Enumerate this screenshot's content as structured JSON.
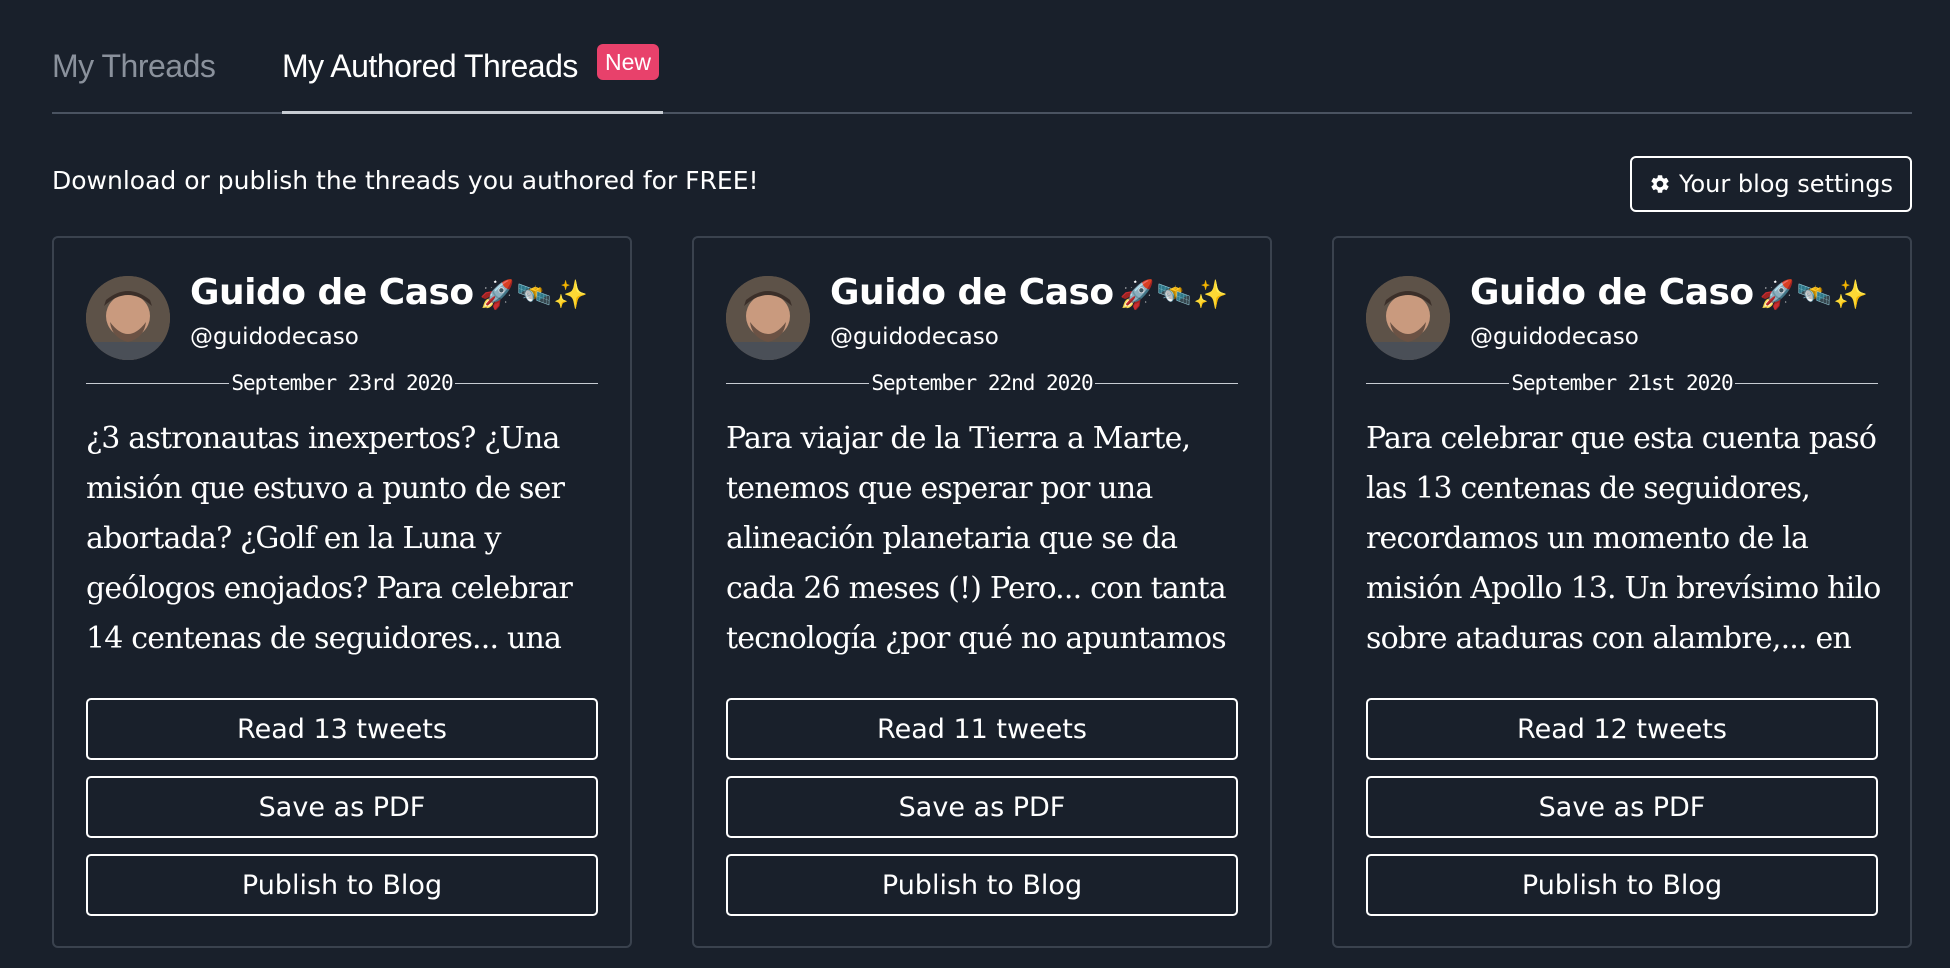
{
  "tabs": {
    "my_threads": "My Threads",
    "my_authored_threads": "My Authored Threads",
    "new_badge": "New"
  },
  "intro": {
    "text": "Download or publish the threads you authored for FREE!",
    "settings_button": "Your blog settings"
  },
  "colors": {
    "background": "#19202b",
    "badge": "#e8416b",
    "card_border": "#3a424e"
  },
  "cards": [
    {
      "author_name": "Guido de Caso",
      "author_emoji": "🚀🛰️✨",
      "handle": "@guidodecaso",
      "date": "September 23rd 2020",
      "excerpt": "¿3 astronautas inexpertos? ¿Una misión que estuvo a punto de ser abortada? ¿Golf en la Luna y geólogos enojados? Para celebrar 14 centenas de seguidores... una",
      "read_label": "Read 13 tweets",
      "pdf_label": "Save as PDF",
      "publish_label": "Publish to Blog"
    },
    {
      "author_name": "Guido de Caso",
      "author_emoji": "🚀🛰️✨",
      "handle": "@guidodecaso",
      "date": "September 22nd 2020",
      "excerpt": "Para viajar de la Tierra a Marte, tenemos que esperar por una alineación planetaria que se da cada 26 meses (!) Pero... con tanta tecnología ¿por qué no apuntamos",
      "read_label": "Read 11 tweets",
      "pdf_label": "Save as PDF",
      "publish_label": "Publish to Blog"
    },
    {
      "author_name": "Guido de Caso",
      "author_emoji": "🚀🛰️✨",
      "handle": "@guidodecaso",
      "date": "September 21st 2020",
      "excerpt": "Para celebrar que esta cuenta pasó las 13 centenas de seguidores, recordamos un momento de la misión Apollo 13. Un brevísimo hilo sobre ataduras con alambre,... en el",
      "read_label": "Read 12 tweets",
      "pdf_label": "Save as PDF",
      "publish_label": "Publish to Blog"
    }
  ]
}
